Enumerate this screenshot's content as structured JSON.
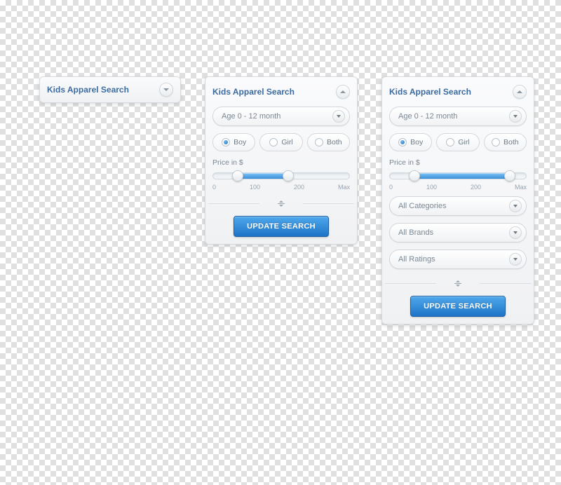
{
  "panel_title": "Kids Apparel Search",
  "age_select": "Age 0 - 12 month",
  "gender": {
    "boy": "Boy",
    "girl": "Girl",
    "both": "Both",
    "selected": "boy"
  },
  "price": {
    "label": "Price in $",
    "ticks": [
      "0",
      "100",
      "200",
      "Max"
    ],
    "mid_panel": {
      "low_pct": 18,
      "high_pct": 55
    },
    "full_panel": {
      "low_pct": 18,
      "high_pct": 88
    }
  },
  "extra_selects": {
    "categories": "All Categories",
    "brands": "All Brands",
    "ratings": "All Ratings"
  },
  "update_button": "UPDATE SEARCH"
}
